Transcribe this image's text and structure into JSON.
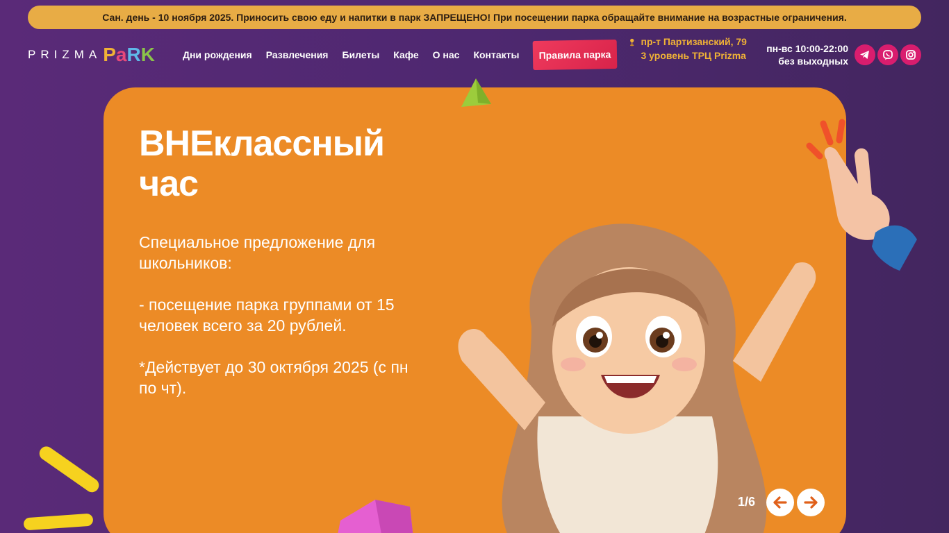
{
  "announcement": "Сан. день - 10 ноября 2025. Приносить свою еду и напитки в парк ЗАПРЕЩЕНО! При посещении парка обращайте внимание на возрастные ограничения.",
  "logo": {
    "prizma": "PRIZMA",
    "park": [
      "P",
      "a",
      "R",
      "K"
    ]
  },
  "nav": [
    "Дни рождения",
    "Развлечения",
    "Билеты",
    "Кафе",
    "О нас",
    "Контакты"
  ],
  "rules_button": "Правила парка",
  "address": "пр-т Партизанский, 79 3 уровень ТРЦ Prizma",
  "hours": {
    "line1": "пн-вс 10:00-22:00",
    "line2": "без выходных"
  },
  "socials": [
    "telegram-icon",
    "viber-icon",
    "instagram-icon"
  ],
  "banner": {
    "title": "ВНЕклассный час",
    "text": "Специальное предложение для школьников:\n\n- посещение парка группами от 15 человек всего за 20 рублей.\n\n*Действует до 30 октября 2025 (с пн по чт).",
    "counter": "1/6"
  },
  "colors": {
    "accent": "#ec8b26",
    "announce": "#e8ac45",
    "rules": "#e8304f",
    "social": "#d91d6e"
  }
}
